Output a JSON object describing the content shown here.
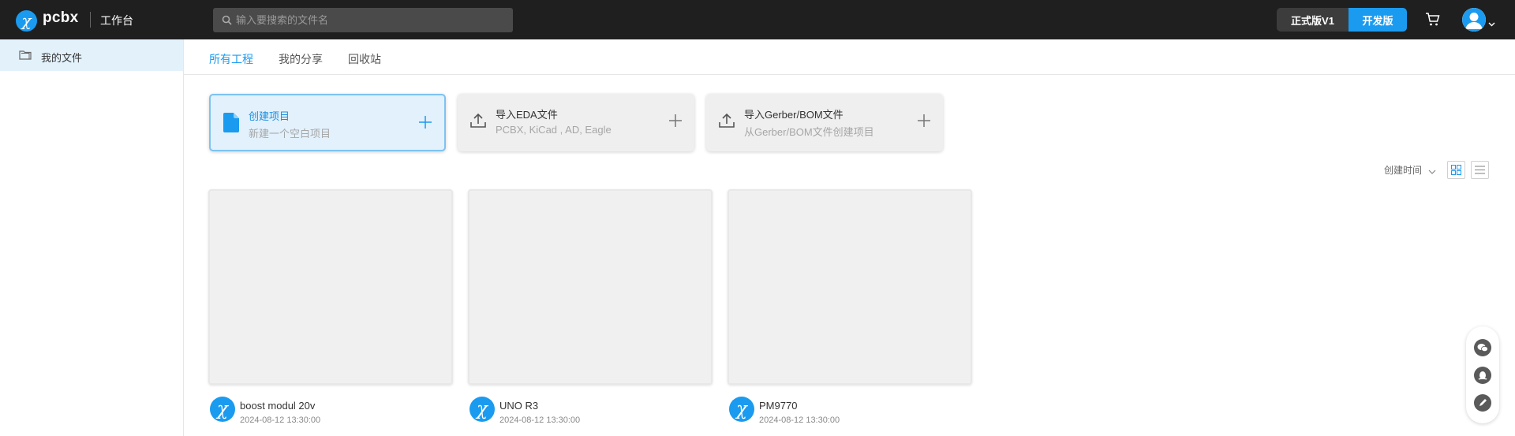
{
  "header": {
    "logo_text": "pcbx",
    "workbench": "工作台",
    "search_placeholder": "输入要搜索的文件名",
    "version_formal": "正式版V1",
    "version_dev": "开发版"
  },
  "sidebar": {
    "items": [
      {
        "label": "我的文件",
        "icon": "folder-icon",
        "active": true
      }
    ]
  },
  "tabs": [
    {
      "label": "所有工程",
      "active": true
    },
    {
      "label": "我的分享",
      "active": false
    },
    {
      "label": "回收站",
      "active": false
    }
  ],
  "actions": [
    {
      "title": "创建项目",
      "subtitle": "新建一个空白项目",
      "icon": "document-icon"
    },
    {
      "title": "导入EDA文件",
      "subtitle": "PCBX, KiCad , AD, Eagle",
      "icon": "upload-icon"
    },
    {
      "title": "导入Gerber/BOM文件",
      "subtitle": "从Gerber/BOM文件创建项目",
      "icon": "upload-icon"
    }
  ],
  "sort": {
    "label": "创建时间"
  },
  "projects": [
    {
      "name": "boost modul 20v",
      "date": "2024-08-12 13:30:00"
    },
    {
      "name": "UNO R3",
      "date": "2024-08-12 13:30:00"
    },
    {
      "name": "PM9770",
      "date": "2024-08-12 13:30:00"
    }
  ],
  "colors": {
    "accent": "#1a9bf0",
    "topbar": "#1f1f1f",
    "sidebar_active": "#e3f1fb"
  }
}
